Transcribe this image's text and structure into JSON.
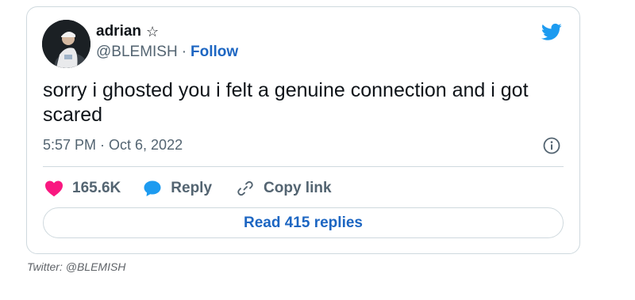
{
  "tweet": {
    "author_name": "adrian",
    "author_badge": "☆",
    "handle": "@BLEMISH",
    "separator": "·",
    "follow_label": "Follow",
    "text": "sorry i ghosted you i felt a genuine connection and i got scared",
    "timestamp": "5:57 PM · Oct 6, 2022",
    "like_count": "165.6K",
    "reply_label": "Reply",
    "copy_link_label": "Copy link",
    "read_replies_label": "Read 415 replies"
  },
  "caption": "Twitter: @BLEMISH",
  "icons": {
    "brand": "twitter-bird-icon",
    "info": "info-icon",
    "like": "heart-icon",
    "reply": "speech-bubble-icon",
    "copy": "link-icon"
  },
  "colors": {
    "twitter_blue": "#1d9bf0",
    "link_blue": "#1d66c2",
    "heart": "#f91880",
    "secondary_text": "#536471",
    "border": "#cfd9de"
  }
}
